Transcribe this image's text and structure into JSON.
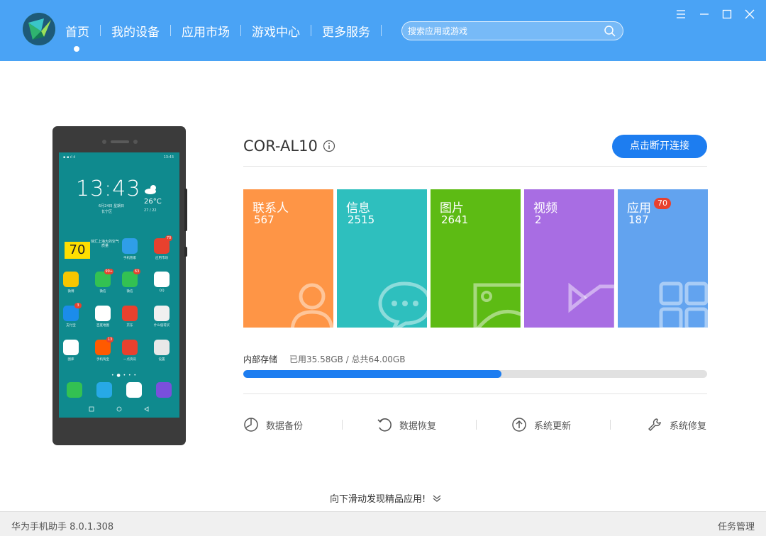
{
  "nav": {
    "items": [
      {
        "label": "首页"
      },
      {
        "label": "我的设备"
      },
      {
        "label": "应用市场"
      },
      {
        "label": "游戏中心"
      },
      {
        "label": "更多服务"
      }
    ]
  },
  "search": {
    "placeholder": "搜索应用或游戏"
  },
  "device": {
    "name": "COR-AL10",
    "disconnect_label": "点击断开连接"
  },
  "tiles": [
    {
      "label": "联系人",
      "count": "567",
      "color": "#fe9546",
      "icon": "contact-icon"
    },
    {
      "label": "信息",
      "count": "2515",
      "color": "#2ebfbe",
      "icon": "message-icon"
    },
    {
      "label": "图片",
      "count": "2641",
      "color": "#5dbb14",
      "icon": "picture-icon"
    },
    {
      "label": "视频",
      "count": "2",
      "color": "#a86de3",
      "icon": "video-icon"
    },
    {
      "label": "应用",
      "count": "187",
      "badge": "70",
      "color": "#62a3ef",
      "icon": "apps-icon"
    }
  ],
  "storage": {
    "label": "内部存储",
    "usage": "已用35.58GB / 总共64.00GB",
    "used_fraction": 0.556
  },
  "actions": [
    {
      "label": "数据备份",
      "icon": "backup-icon"
    },
    {
      "label": "数据恢复",
      "icon": "restore-icon"
    },
    {
      "label": "系统更新",
      "icon": "update-icon"
    },
    {
      "label": "系统修复",
      "icon": "repair-icon"
    }
  ],
  "scroll_hint": "向下滑动发现精品应用!",
  "footer": {
    "version": "华为手机助手 8.0.1.308",
    "task_manager": "任务管理"
  },
  "phone": {
    "time": "13:43",
    "date": "6月24日 星期日",
    "location": "长宁区",
    "temperature": "26°C",
    "temp_range": "27 / 22",
    "widget_number": "70",
    "widget_text": "徐汇上海大的空气质量",
    "apps": [
      {
        "label": "手机管家",
        "color": "#2f9ee8",
        "icon": "shield-icon"
      },
      {
        "label": "应用市场",
        "color": "#e8412e",
        "icon": "appstore-icon",
        "badge": "70"
      },
      {
        "label": "微博",
        "color": "#f7c600",
        "icon": "weibo-icon"
      },
      {
        "label": "微信",
        "color": "#33c152",
        "icon": "wechat-icon",
        "badge": "99+"
      },
      {
        "label": "微信",
        "color": "#33c152",
        "icon": "wechat-icon",
        "badge": "63"
      },
      {
        "label": "QQ",
        "color": "#ffffff",
        "icon": "qq-icon"
      },
      {
        "label": "支付宝",
        "color": "#1b8ceb",
        "icon": "alipay-icon",
        "badge": "3"
      },
      {
        "label": "百度地图",
        "color": "#ffffff",
        "icon": "map-icon"
      },
      {
        "label": "京东",
        "color": "#e8412e",
        "icon": "jd-icon"
      },
      {
        "label": "什么值得买",
        "color": "#f0f0f0",
        "icon": "smzdm-icon"
      },
      {
        "label": "图库",
        "color": "#ffffff",
        "icon": "gallery-icon"
      },
      {
        "label": "手机淘宝",
        "color": "#ff5a00",
        "icon": "taobao-icon",
        "badge": "13"
      },
      {
        "label": "一点资讯",
        "color": "#e8412e",
        "icon": "news-icon"
      },
      {
        "label": "设置",
        "color": "#e8e8e8",
        "icon": "settings-icon"
      }
    ],
    "dock": [
      {
        "color": "#33c152",
        "icon": "phone-call-icon"
      },
      {
        "color": "#27a9e6",
        "icon": "sms-icon"
      },
      {
        "color": "#ffffff",
        "icon": "camera-icon"
      },
      {
        "color": "#7a4fdc",
        "icon": "browser-icon"
      }
    ]
  }
}
